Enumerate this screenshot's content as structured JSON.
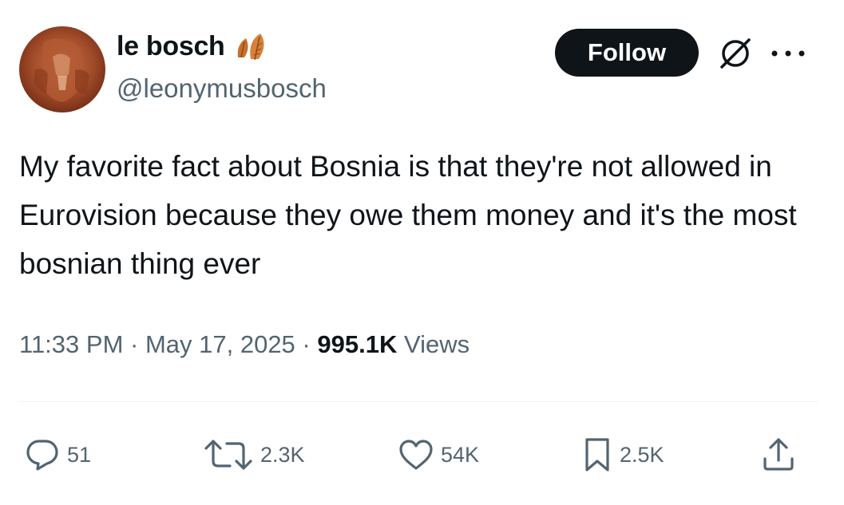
{
  "user": {
    "display_name": "le bosch",
    "handle": "@leonymusbosch"
  },
  "header": {
    "follow_label": "Follow"
  },
  "tweet": {
    "text": "My favorite fact about Bosnia is that they're not allowed in Eurovision because they owe them money and it's the most bosnian thing ever",
    "time": "11:33 PM",
    "date": "May 17, 2025",
    "separator": " · ",
    "views_count": "995.1K",
    "views_label": " Views"
  },
  "actions": {
    "replies": "51",
    "reposts": "2.3K",
    "likes": "54K",
    "bookmarks": "2.5K"
  },
  "icons": {
    "reply": "reply-icon",
    "repost": "repost-icon",
    "like": "heart-icon",
    "bookmark": "bookmark-icon",
    "share": "share-icon",
    "grok": "grok-icon",
    "more": "more-icon"
  },
  "colors": {
    "text_primary": "#0f1419",
    "text_secondary": "#536471",
    "follow_bg": "#0f1419",
    "follow_text": "#ffffff",
    "leaf_emoji": "#d2782e"
  }
}
